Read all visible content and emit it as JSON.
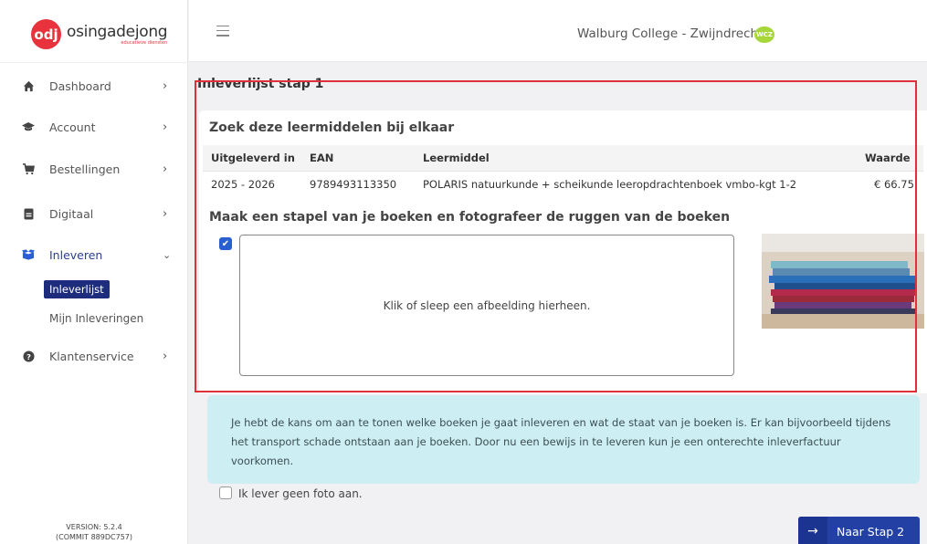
{
  "brand": {
    "mark": "odj",
    "name": "osingadejong",
    "sub": "educatieve diensten",
    "color": "#e8333c"
  },
  "header": {
    "school": "Walburg College - Zwijndrecht",
    "school_badge": "WCZ"
  },
  "sidebar": {
    "items": [
      {
        "label": "Dashboard",
        "icon": "home-icon"
      },
      {
        "label": "Account",
        "icon": "graduation-cap-icon"
      },
      {
        "label": "Bestellingen",
        "icon": "cart-icon"
      },
      {
        "label": "Digitaal",
        "icon": "tablet-icon"
      },
      {
        "label": "Inleveren",
        "icon": "box-icon"
      },
      {
        "label": "Klantenservice",
        "icon": "help-icon"
      }
    ],
    "sub_items": {
      "active": "Inleverlijst",
      "other": "Mijn Inleveringen"
    },
    "version": "VERSION: 5.2.4",
    "commit": "(COMMIT 889DC757)"
  },
  "main": {
    "step_title": "Inleverlijst stap 1",
    "card_title": "Zoek deze leermiddelen bij elkaar",
    "table": {
      "headers": [
        "Uitgeleverd in",
        "EAN",
        "Leermiddel",
        "Waarde"
      ],
      "rows": [
        [
          "2025 - 2026",
          "9789493113350",
          "POLARIS natuurkunde + scheikunde leeropdrachtenboek vmbo-kgt 1-2",
          "€ 66.75"
        ]
      ]
    },
    "photo_title": "Maak een stapel van je boeken en fotografeer de ruggen van de boeken",
    "dropzone_text": "Klik of sleep een afbeelding hierheen.",
    "info_text": "Je hebt de kans om aan te tonen welke boeken je gaat inleveren en wat de staat van je boeken is. Er kan bijvoorbeeld tijdens het transport schade ontstaan aan je boeken. Door nu een bewijs in te leveren kun je een onterechte inleverfactuur voorkomen.",
    "no_photo_label": "Ik lever geen foto aan.",
    "next_label": "Naar Stap 2"
  }
}
